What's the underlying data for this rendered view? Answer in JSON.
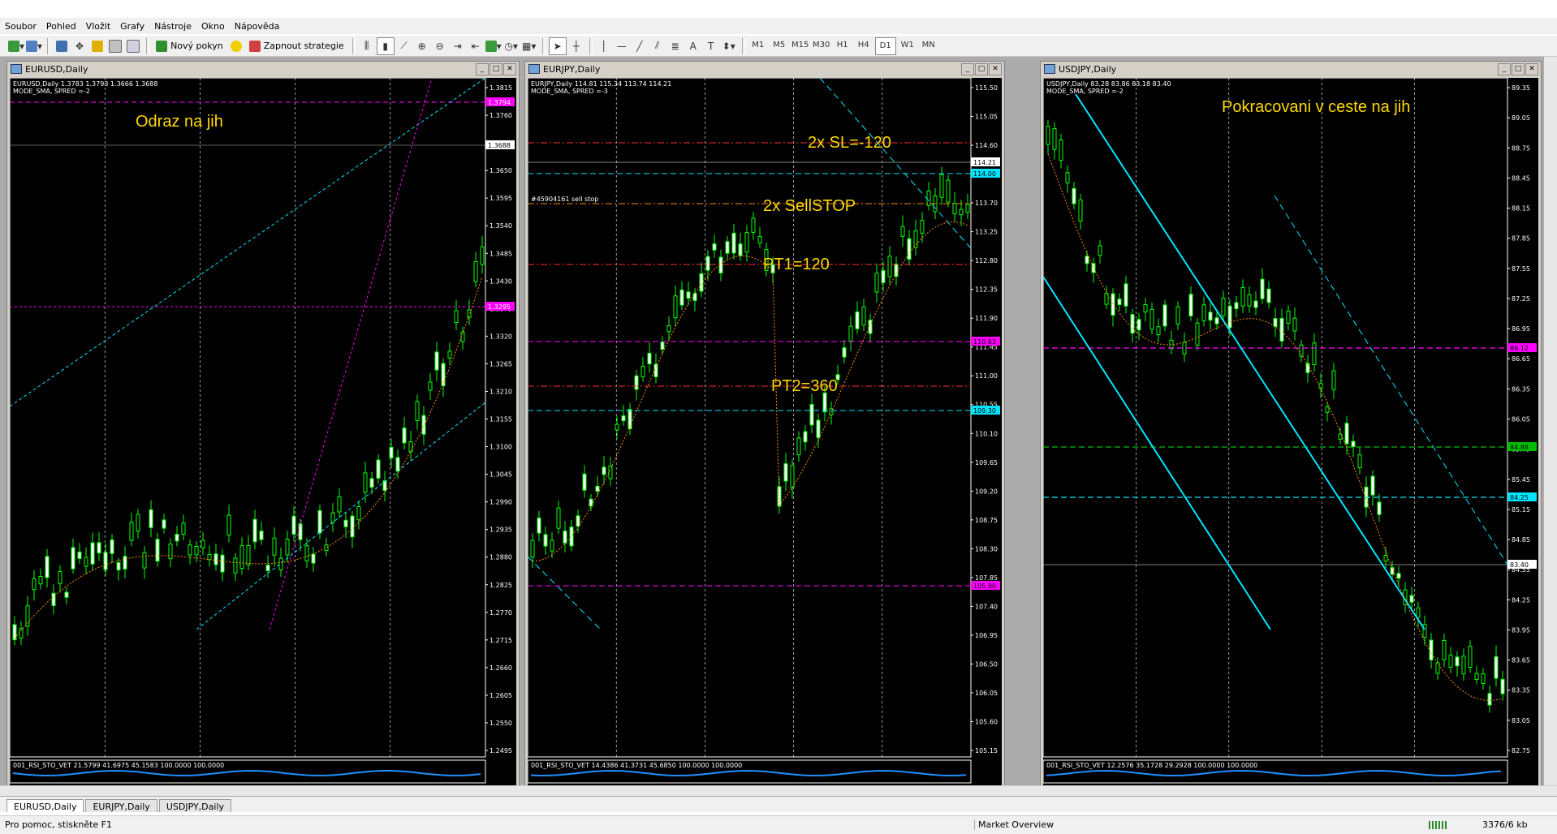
{
  "menu": [
    "Soubor",
    "Pohled",
    "Vložit",
    "Grafy",
    "Nástroje",
    "Okno",
    "Nápověda"
  ],
  "toolbar": {
    "new_order": "Nový pokyn",
    "autotrade": "Zapnout strategie",
    "timeframes": [
      "M1",
      "M5",
      "M15",
      "M30",
      "H1",
      "H4",
      "D1",
      "W1",
      "MN"
    ],
    "selected_tf": "D1"
  },
  "windows": [
    {
      "title": "EURUSD,Daily",
      "info1": "EURUSD,Daily  1.3783 1.3793 1.3666 1.3688",
      "info2": "MODE_SMA, SPRED =-2",
      "annotation": "Odraz na jih",
      "price_ticks": [
        "1.3815",
        "1.3760",
        "1.3705",
        "1.3650",
        "1.3595",
        "1.3540",
        "1.3485",
        "1.3430",
        "1.3375",
        "1.3320",
        "1.3265",
        "1.3210",
        "1.3155",
        "1.3100",
        "1.3045",
        "1.2990",
        "1.2935",
        "1.2880",
        "1.2825",
        "1.2770",
        "1.2715",
        "1.2660",
        "1.2605",
        "1.2550",
        "1.2495"
      ],
      "tags": [
        {
          "text": "1.3794",
          "color": "#ff00ff"
        },
        {
          "text": "1.3688",
          "color": "#ffffff"
        },
        {
          "text": "1.3295",
          "color": "#ff00ff"
        }
      ],
      "indicator": "001_RSI_STO_VET  21.5799 41.6975 45.1583 100.0000 100.0000"
    },
    {
      "title": "EURJPY,Daily",
      "info1": "EURJPY,Daily  114.81 115.34 113.74 114.21",
      "info2": "MODE_SMA, SPRED =-3",
      "annotations": [
        "2x SL=-120",
        "2x SellSTOP",
        "PT1=120",
        "PT2=360"
      ],
      "order_label": "#45904161 sell stop",
      "price_ticks": [
        "115.50",
        "115.05",
        "114.60",
        "114.15",
        "113.70",
        "113.25",
        "112.80",
        "112.35",
        "111.90",
        "111.45",
        "111.00",
        "110.55",
        "110.10",
        "109.65",
        "109.20",
        "108.75",
        "108.30",
        "107.85",
        "107.40",
        "106.95",
        "106.50",
        "106.05",
        "105.60",
        "105.15"
      ],
      "tags": [
        {
          "text": "114.21",
          "color": "#ffffff"
        },
        {
          "text": "114.00",
          "color": "#00e5ff"
        },
        {
          "text": "110.63",
          "color": "#ff00ff"
        },
        {
          "text": "109.30",
          "color": "#00e5ff"
        },
        {
          "text": "105.80",
          "color": "#ff00ff"
        }
      ],
      "indicator": "001_RSI_STO_VET  14.4386 41.3731 45.6850 100.0000 100.0000"
    },
    {
      "title": "USDJPY,Daily",
      "info1": "USDJPY,Daily  83.28 83.86 83.18 83.40",
      "info2": "MODE_SMA, SPRED =-2",
      "annotation": "Pokracovani v ceste na jih",
      "price_ticks": [
        "89.35",
        "89.05",
        "88.75",
        "88.45",
        "88.15",
        "87.85",
        "87.55",
        "87.25",
        "86.95",
        "86.65",
        "86.35",
        "86.05",
        "85.75",
        "85.45",
        "85.15",
        "84.85",
        "84.55",
        "84.25",
        "83.95",
        "83.65",
        "83.35",
        "83.05",
        "82.75"
      ],
      "tags": [
        {
          "text": "86.12",
          "color": "#ff00ff"
        },
        {
          "text": "84.88",
          "color": "#00c000"
        },
        {
          "text": "84.25",
          "color": "#00e5ff"
        },
        {
          "text": "83.40",
          "color": "#ffffff"
        }
      ],
      "indicator": "001_RSI_STO_VET  12.2576 35.1728 29.2928 100.0000 100.0000"
    }
  ],
  "tabs": [
    "EURUSD,Daily",
    "EURJPY,Daily",
    "USDJPY,Daily"
  ],
  "status": {
    "help": "Pro pomoc, stiskněte F1",
    "profile": "Market Overview",
    "traffic": "3376/6 kb"
  }
}
